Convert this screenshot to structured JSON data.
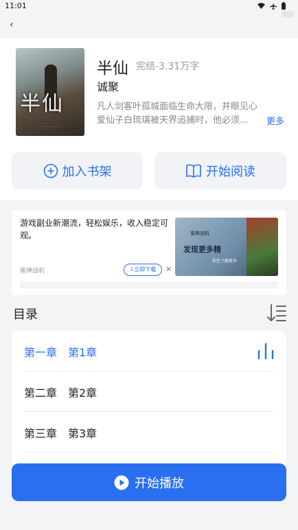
{
  "status_bar": {
    "time": "11:01"
  },
  "nav": {
    "back_label": "‹"
  },
  "book": {
    "title": "半仙",
    "status": "完结-3.31万字",
    "author": "诚聚",
    "description_lines": [
      "凡人剑客叶孤城面临生命大限，并眼见心",
      "爱仙子白琉璃被天界追捕时，他必须…"
    ],
    "more_label": "更多",
    "cover_title": "半仙"
  },
  "actions": {
    "add_shelf_label": "加入书架",
    "start_read_label": "开始阅读"
  },
  "ad": {
    "text": "游戏副业新潮流，轻松娱乐，收入稳定可观。",
    "source": "蜜神战机",
    "download_label": "立即下载",
    "close_label": "×",
    "image_text": "发现更多精",
    "image_logo": "蜜蜂战机",
    "image_sub": "你生了解更多"
  },
  "toc": {
    "title": "目录",
    "chapters": [
      {
        "label": "第一章　第1章",
        "active": true
      },
      {
        "label": "第二章　第2章",
        "active": false
      },
      {
        "label": "第三章　第3章",
        "active": false
      }
    ]
  },
  "play": {
    "label": "开始播放"
  },
  "colors": {
    "accent": "#2a6ff0",
    "background": "#f3f4f6"
  },
  "icons": [
    "wifi-icon",
    "airplane-icon",
    "battery-icon",
    "plus-circle-icon",
    "book-open-icon",
    "sort-icon",
    "playing-bars-icon",
    "play-circle-icon"
  ]
}
